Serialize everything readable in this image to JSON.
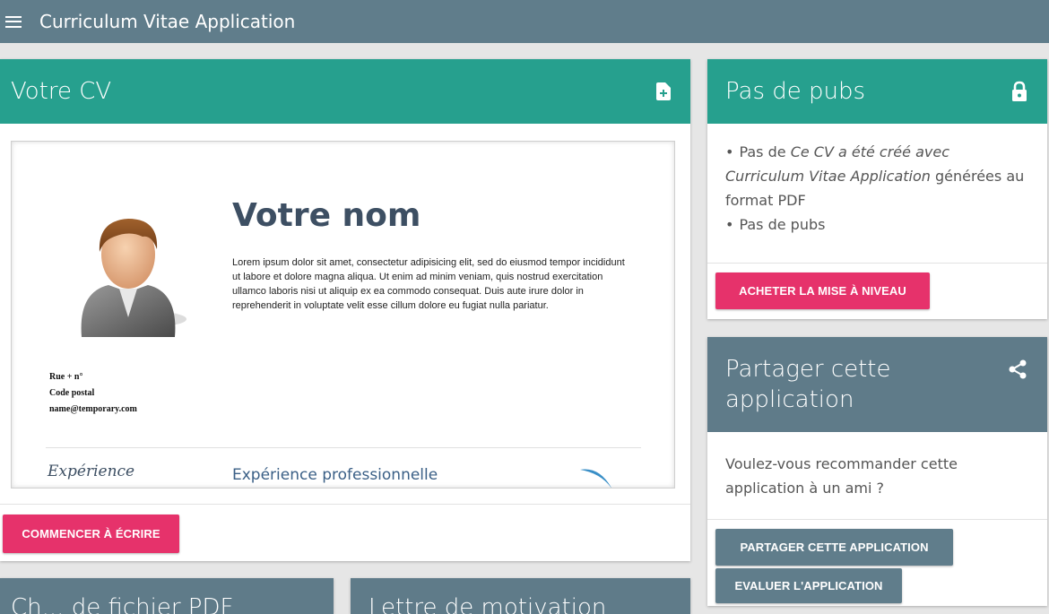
{
  "appbar": {
    "title": "Curriculum Vitae Application",
    "menu_icon": "hamburger-menu-icon"
  },
  "cv_card": {
    "title": "Votre CV",
    "icon": "add-document-icon",
    "preview": {
      "name": "Votre nom",
      "lorem": "Lorem ipsum dolor sit amet, consectetur adipisicing elit, sed do eiusmod tempor incididunt ut labore et dolore magna aliqua. Ut enim ad minim veniam, quis nostrud exercitation ullamco laboris nisi ut aliquip ex ea commodo consequat. Duis aute irure dolor in reprehenderit in voluptate velit esse cillum dolore eu fugiat nulla pariatur.",
      "address_street": "Rue + n°",
      "address_postal": "Code postal",
      "email": "name@temporary.com",
      "section_left": "Expérience",
      "section_right": "Expérience professionnelle"
    },
    "start_button": "COMMENCER À ÉCRIRE"
  },
  "no_ads_card": {
    "title": "Pas de pubs",
    "icon": "lock-icon",
    "bullet1_prefix": "Pas de ",
    "bullet1_italic": "Ce CV a été créé avec Curriculum Vitae Application",
    "bullet1_suffix": "générées au format PDF",
    "bullet2": "Pas de pubs",
    "buy_button": "ACHETER LA MISE À NIVEAU"
  },
  "share_card": {
    "title": "Partager cette application",
    "icon": "share-icon",
    "text": "Voulez-vous recommander cette application à un ami ?",
    "share_button": "PARTAGER CETTE APPLICATION",
    "rate_button": "EVALUER L'APPLICATION"
  },
  "bottom_cards": {
    "left_title": "Ch... de fichier PDF",
    "right_title": "Lettre de motivation"
  },
  "colors": {
    "appbar": "#607d8b",
    "teal": "#26a08e",
    "slate": "#5f7b89",
    "accent": "#e6326b"
  }
}
